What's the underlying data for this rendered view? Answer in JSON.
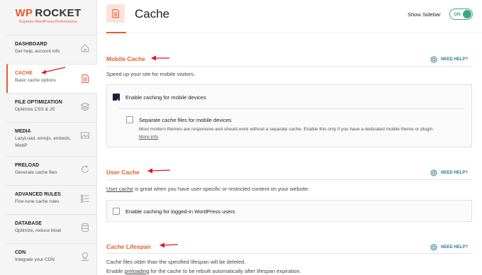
{
  "logo": {
    "wp": "WP",
    "name": "ROCKET",
    "tagline": "Superior WordPress Performance"
  },
  "sidebar": {
    "items": [
      {
        "title": "DASHBOARD",
        "desc": "Get help, account info",
        "icon": "home-icon"
      },
      {
        "title": "CACHE",
        "desc": "Basic cache options",
        "icon": "document-icon"
      },
      {
        "title": "FILE OPTIMIZATION",
        "desc": "Optimize CSS & JS",
        "icon": "layers-icon"
      },
      {
        "title": "MEDIA",
        "desc": "LazyLoad, emojis, embeds,",
        "desc2": "WebP",
        "icon": "image-icon"
      },
      {
        "title": "PRELOAD",
        "desc": "Generate cache files",
        "icon": "refresh-icon"
      },
      {
        "title": "ADVANCED RULES",
        "desc": "Fine-tune cache rules",
        "icon": "list-icon"
      },
      {
        "title": "DATABASE",
        "desc": "Optimize, reduce bloat",
        "icon": "database-icon"
      },
      {
        "title": "CDN",
        "desc": "Integrate your CDN",
        "icon": "cdn-icon"
      }
    ]
  },
  "header": {
    "title": "Cache",
    "show_sidebar_label": "Show Sidebar",
    "toggle_state": "ON"
  },
  "help_label": "NEED HELP?",
  "mobile_cache": {
    "title": "Mobile Cache",
    "description": "Speed up your site for mobile visitors.",
    "enable_label": "Enable caching for mobile devices",
    "enable_checked": true,
    "separate_label": "Separate cache files for mobile devices",
    "separate_checked": false,
    "separate_desc": "Most modern themes are responsive and should work without a separate cache. Enable this only if you have a dedicated mobile theme or plugin.",
    "more_info": "More info"
  },
  "user_cache": {
    "title": "User Cache",
    "description_link": "User cache",
    "description_rest": " is great when you have user-specific or restricted content on your website.",
    "enable_label": "Enable caching for logged-in WordPress users",
    "enable_checked": false
  },
  "cache_lifespan": {
    "title": "Cache Lifespan",
    "line1": "Cache files older than the specified lifespan will be deleted.",
    "line2_pre": "Enable ",
    "line2_link": "preloading",
    "line2_post": " for the cache to be rebuilt automatically after lifespan expiration."
  },
  "colors": {
    "accent": "#e85b2f",
    "toggle": "#3fa87b",
    "help": "#2a7a9a",
    "arrow": "#e0151a"
  }
}
